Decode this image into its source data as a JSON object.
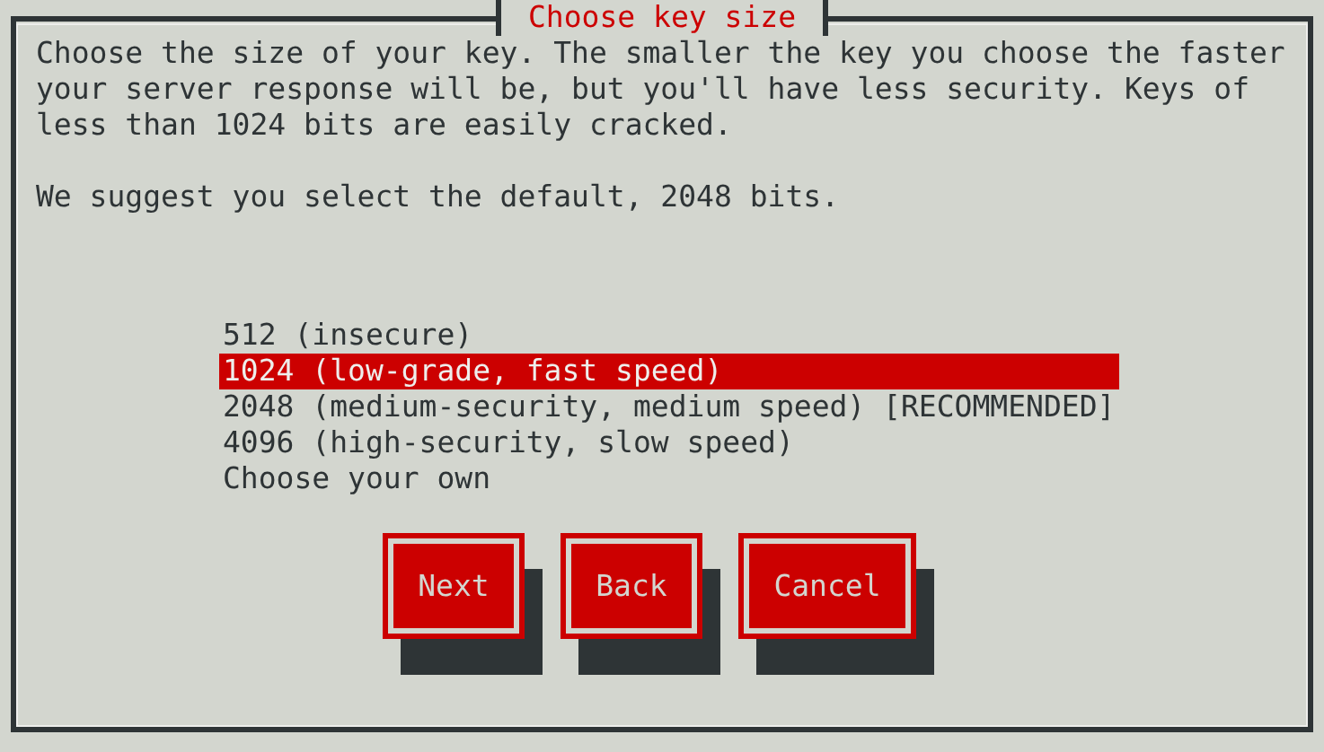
{
  "dialog": {
    "title": "Choose key size",
    "paragraphs": [
      "Choose the size of your key. The smaller the key you choose the faster your server response will be, but you'll have less security. Keys of less than 1024 bits are easily cracked.",
      "We suggest you select the default, 2048 bits."
    ],
    "options": [
      {
        "label": "512 (insecure)",
        "selected": false
      },
      {
        "label": "1024 (low-grade, fast speed)",
        "selected": true
      },
      {
        "label": "2048 (medium-security, medium speed) [RECOMMENDED]",
        "selected": false
      },
      {
        "label": "4096 (high-security, slow speed)",
        "selected": false
      },
      {
        "label": "Choose your own",
        "selected": false
      }
    ],
    "buttons": [
      "Next",
      "Back",
      "Cancel"
    ]
  }
}
